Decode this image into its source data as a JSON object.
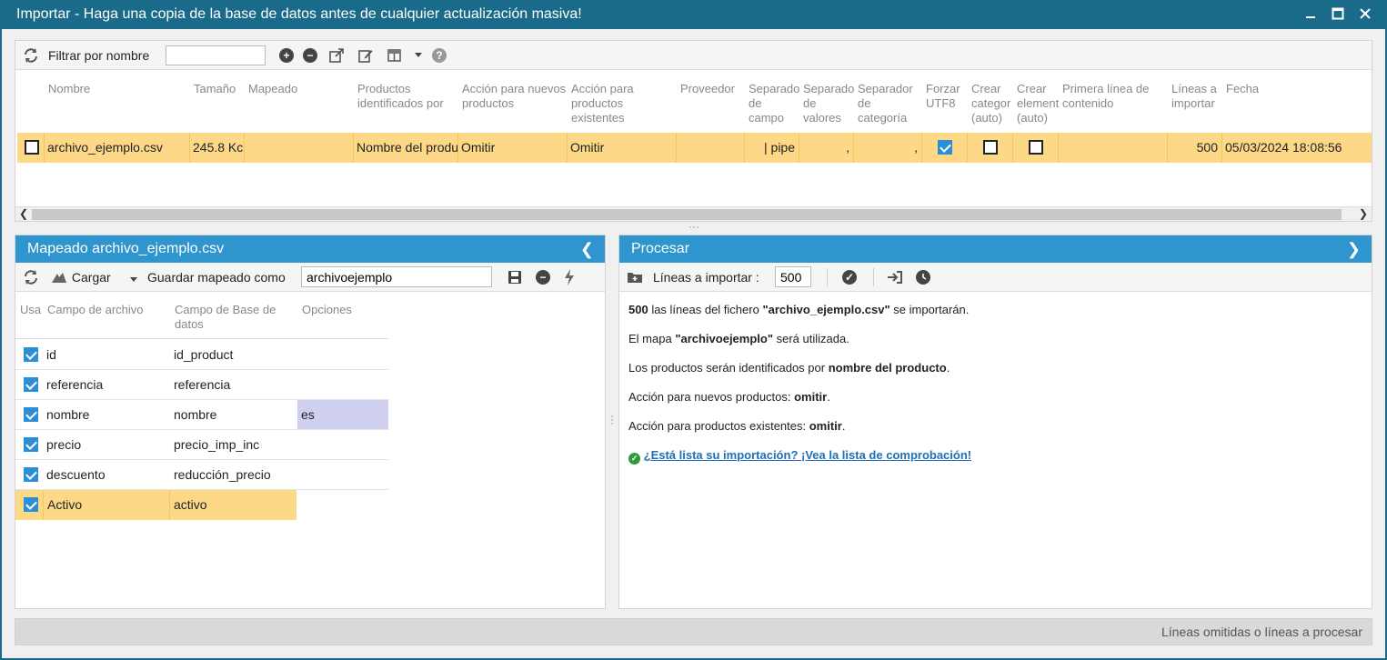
{
  "window": {
    "title": "Importar - Haga una copia de la base de datos antes de cualquier actualización masiva!"
  },
  "top_toolbar": {
    "filter_label": "Filtrar por nombre",
    "filter_value": ""
  },
  "import_grid": {
    "headers": {
      "nombre": "Nombre",
      "tamano": "Tamaño",
      "mapeado": "Mapeado",
      "productos_identificados": [
        "Productos",
        "identificados por"
      ],
      "accion_nuevos": [
        "Acción para nuevos",
        "productos"
      ],
      "accion_existentes": [
        "Acción para",
        "productos",
        "existentes"
      ],
      "proveedor": "Proveedor",
      "separador_campo": [
        "Separado",
        "de",
        "campo"
      ],
      "separador_valores": [
        "Separado",
        "de",
        "valores"
      ],
      "separador_categoria": [
        "Separador",
        "de",
        "categoría"
      ],
      "forzar_utf8": [
        "Forzar",
        "UTF8"
      ],
      "crear_categorias": [
        "Crear",
        "categor",
        "(auto)"
      ],
      "crear_elementos": [
        "Crear",
        "element",
        "(auto)"
      ],
      "primera_linea": [
        "Primera línea de",
        "contenido"
      ],
      "lineas_importar": [
        "Líneas a",
        "importar"
      ],
      "fecha": "Fecha"
    },
    "row": {
      "nombre": "archivo_ejemplo.csv",
      "tamano": "245.8 Kc",
      "mapeado": "",
      "productos_identificados": "Nombre del produ",
      "accion_nuevos": "Omitir",
      "accion_existentes": "Omitir",
      "proveedor": "",
      "separador_campo": "| pipe",
      "separador_valores": ",",
      "separador_categoria": ",",
      "forzar_utf8": true,
      "crear_categorias": false,
      "crear_elementos": false,
      "primera_linea": "",
      "lineas_importar": "500",
      "fecha": "05/03/2024 18:08:56"
    }
  },
  "mapping_panel": {
    "title": "Mapeado archivo_ejemplo.csv",
    "load_label": "Cargar",
    "save_as_label": "Guardar mapeado como",
    "save_as_value": "archivoejemplo",
    "headers": {
      "usa": "Usa",
      "campo_archivo": "Campo de archivo",
      "campo_bd": [
        "Campo de Base de",
        "datos"
      ],
      "opciones": "Opciones"
    },
    "rows": [
      {
        "usa": true,
        "campo_archivo": "id",
        "campo_bd": "id_product",
        "opciones": ""
      },
      {
        "usa": true,
        "campo_archivo": "referencia",
        "campo_bd": "referencia",
        "opciones": ""
      },
      {
        "usa": true,
        "campo_archivo": "nombre",
        "campo_bd": "nombre",
        "opciones": "es"
      },
      {
        "usa": true,
        "campo_archivo": "precio",
        "campo_bd": "precio_imp_inc",
        "opciones": ""
      },
      {
        "usa": true,
        "campo_archivo": "descuento",
        "campo_bd": "reducción_precio",
        "opciones": ""
      },
      {
        "usa": true,
        "campo_archivo": "Activo",
        "campo_bd": "activo",
        "opciones": ""
      }
    ]
  },
  "process_panel": {
    "title": "Procesar",
    "lines_label": "Líneas a importar :",
    "lines_value": "500",
    "summary": {
      "l1_count": "500",
      "l1_text": " las líneas del fichero ",
      "l1_file": "\"archivo_ejemplo.csv\"",
      "l1_end": " se importarán.",
      "l2_text": "El mapa ",
      "l2_map": "\"archivoejemplo\"",
      "l2_end": " será utilizada.",
      "l3_text": "Los productos serán identificados por ",
      "l3_value": "nombre del producto",
      "l3_end": ".",
      "l4_text": "Acción para nuevos productos: ",
      "l4_value": "omitir",
      "l4_end": ".",
      "l5_text": "Acción para productos existentes: ",
      "l5_value": "omitir",
      "l5_end": ".",
      "checklist_link": "¿Está lista su importación? ¡Vea la lista de comprobación!"
    }
  },
  "statusbar": {
    "text": "Líneas omitidas o líneas a procesar"
  },
  "colors": {
    "title_bar": "#1a6a8a",
    "panel_header": "#2f95ce",
    "row_selected": "#fdd987",
    "option_highlight": "#cfcfef",
    "checkbox_on": "#2a8fd6"
  }
}
